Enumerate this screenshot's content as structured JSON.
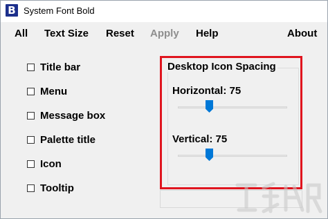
{
  "window": {
    "title": "System Font Bold",
    "icon_letter": "B",
    "icon_color": "#1c2f8c"
  },
  "menu": {
    "items": [
      {
        "label": "All",
        "enabled": true
      },
      {
        "label": "Text Size",
        "enabled": true
      },
      {
        "label": "Reset",
        "enabled": true
      },
      {
        "label": "Apply",
        "enabled": false
      },
      {
        "label": "Help",
        "enabled": true
      },
      {
        "label": "About",
        "enabled": true
      }
    ]
  },
  "options": [
    {
      "label": "Title bar",
      "checked": false
    },
    {
      "label": "Menu",
      "checked": false
    },
    {
      "label": "Message box",
      "checked": false
    },
    {
      "label": "Palette title",
      "checked": false
    },
    {
      "label": "Icon",
      "checked": false
    },
    {
      "label": "Tooltip",
      "checked": false
    }
  ],
  "spacing": {
    "title": "Desktop Icon Spacing",
    "horizontal": {
      "label": "Horizontal: 75",
      "value": 75,
      "level": 0.27
    },
    "vertical": {
      "label": "Vertical: 75",
      "value": 75,
      "level": 0.27
    }
  },
  "highlight_color": "#e0141e",
  "accent_color": "#0078d7"
}
